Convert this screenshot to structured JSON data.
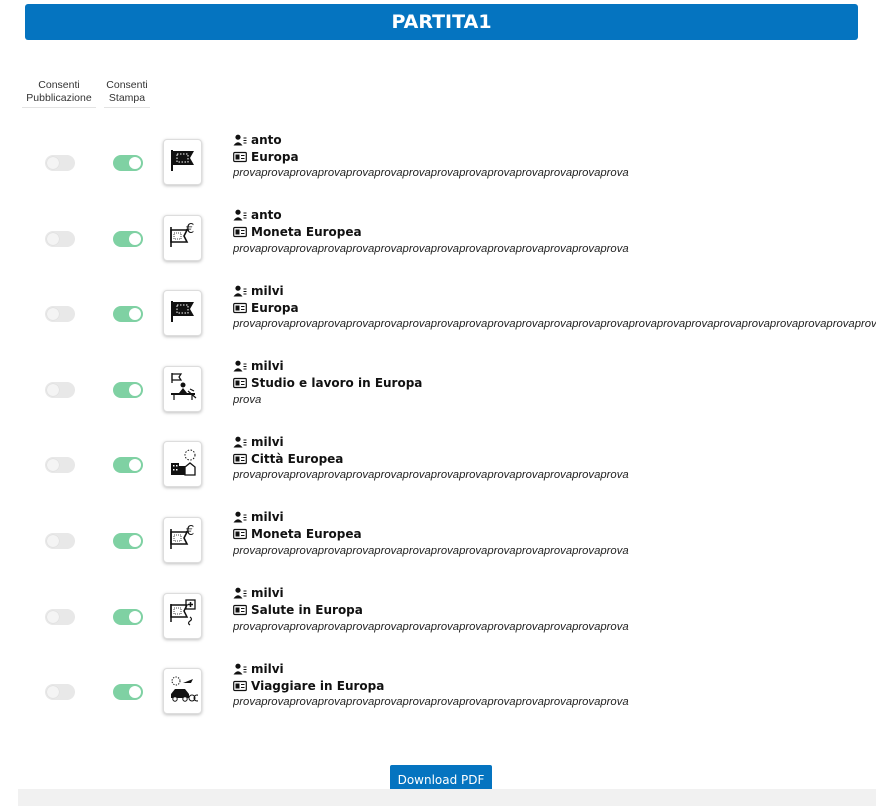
{
  "header": {
    "title": "PARTITA1"
  },
  "columns": {
    "publication": "Consenti Pubblicazione",
    "publication_line1": "Consenti",
    "publication_line2": "Pubblicazione",
    "print_line1": "Consenti",
    "print_line2": "Stampa"
  },
  "colors": {
    "accent": "#0574c0",
    "toggle_on": "#7fd1a3",
    "toggle_off": "#e8e8e8"
  },
  "rows": [
    {
      "user": "anto",
      "card": "Europa",
      "icon": "europe-flag-icon",
      "publication_enabled": false,
      "print_enabled": true,
      "text": "provaprovaprovaprovaprovaprovaprovaprovaprovaprovaprovaprovaprovaprova"
    },
    {
      "user": "anto",
      "card": "Moneta Europea",
      "icon": "euro-currency-icon",
      "publication_enabled": false,
      "print_enabled": true,
      "text": "provaprovaprovaprovaprovaprovaprovaprovaprovaprovaprovaprovaprovaprova"
    },
    {
      "user": "milvi",
      "card": "Europa",
      "icon": "europe-flag-icon",
      "publication_enabled": false,
      "print_enabled": true,
      "text": "provaprovaprovaprovaprovaprovaprovaprovaprovaprovaprovaprovaprovaprovaprovaprovaprovaprovaprovaprovaprovaprovaprovap"
    },
    {
      "user": "milvi",
      "card": "Studio e lavoro in Europa",
      "icon": "study-work-icon",
      "publication_enabled": false,
      "print_enabled": true,
      "text": "prova"
    },
    {
      "user": "milvi",
      "card": "Città Europea",
      "icon": "european-city-icon",
      "publication_enabled": false,
      "print_enabled": true,
      "text": "provaprovaprovaprovaprovaprovaprovaprovaprovaprovaprovaprovaprovaprova"
    },
    {
      "user": "milvi",
      "card": "Moneta Europea",
      "icon": "euro-currency-icon",
      "publication_enabled": false,
      "print_enabled": true,
      "text": "provaprovaprovaprovaprovaprovaprovaprovaprovaprovaprovaprovaprovaprova"
    },
    {
      "user": "milvi",
      "card": "Salute in Europa",
      "icon": "health-icon",
      "publication_enabled": false,
      "print_enabled": true,
      "text": "provaprovaprovaprovaprovaprovaprovaprovaprovaprovaprovaprovaprovaprova"
    },
    {
      "user": "milvi",
      "card": "Viaggiare in Europa",
      "icon": "travel-icon",
      "publication_enabled": false,
      "print_enabled": true,
      "text": "provaprovaprovaprovaprovaprovaprovaprovaprovaprovaprovaprovaprovaprova"
    }
  ],
  "footer": {
    "download_label": "Download PDF"
  }
}
